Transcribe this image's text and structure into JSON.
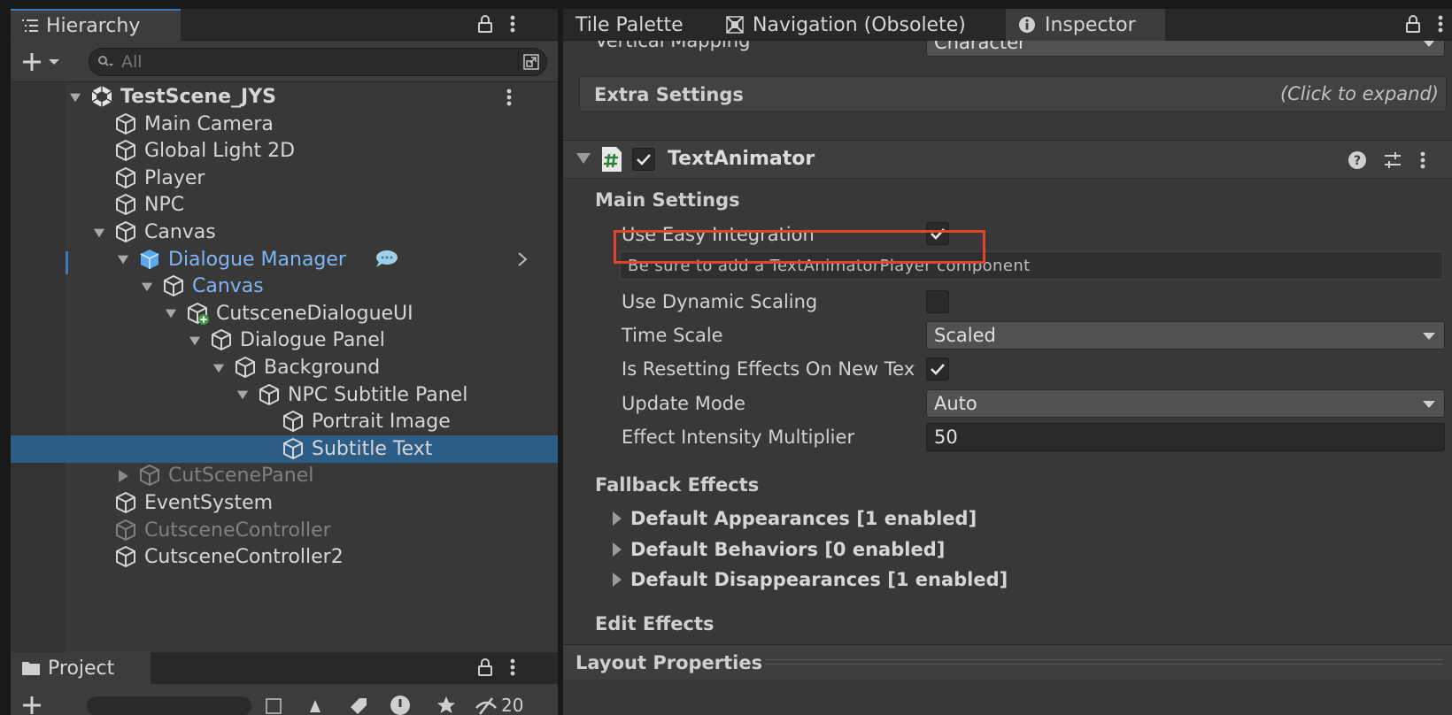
{
  "hierarchy": {
    "tab_label": "Hierarchy",
    "search_placeholder": "All",
    "rows": [
      {
        "label": "TestScene_JYS",
        "depth": 0,
        "arrow": "down",
        "icon": "unity-scene",
        "style": "bold"
      },
      {
        "label": "Main Camera",
        "depth": 1,
        "arrow": "",
        "icon": "cube",
        "style": ""
      },
      {
        "label": "Global Light 2D",
        "depth": 1,
        "arrow": "",
        "icon": "cube",
        "style": ""
      },
      {
        "label": "Player",
        "depth": 1,
        "arrow": "",
        "icon": "cube",
        "style": ""
      },
      {
        "label": "NPC",
        "depth": 1,
        "arrow": "",
        "icon": "cube",
        "style": ""
      },
      {
        "label": "Canvas",
        "depth": 1,
        "arrow": "down",
        "icon": "cube",
        "style": ""
      },
      {
        "label": "Dialogue Manager",
        "depth": 2,
        "arrow": "down",
        "icon": "prefab-cube",
        "style": "blue"
      },
      {
        "label": "Canvas",
        "depth": 3,
        "arrow": "down",
        "icon": "cube",
        "style": "blue"
      },
      {
        "label": "CutsceneDialogueUI",
        "depth": 4,
        "arrow": "down",
        "icon": "cube-added",
        "style": ""
      },
      {
        "label": "Dialogue Panel",
        "depth": 5,
        "arrow": "down",
        "icon": "cube",
        "style": ""
      },
      {
        "label": "Background",
        "depth": 6,
        "arrow": "down",
        "icon": "cube",
        "style": ""
      },
      {
        "label": "NPC Subtitle Panel",
        "depth": 7,
        "arrow": "down",
        "icon": "cube",
        "style": ""
      },
      {
        "label": "Portrait Image",
        "depth": 8,
        "arrow": "",
        "icon": "cube",
        "style": ""
      },
      {
        "label": "Subtitle Text",
        "depth": 8,
        "arrow": "",
        "icon": "cube",
        "style": "selected"
      },
      {
        "label": "CutScenePanel",
        "depth": 2,
        "arrow": "right",
        "icon": "cube",
        "style": "dim"
      },
      {
        "label": "EventSystem",
        "depth": 1,
        "arrow": "",
        "icon": "cube",
        "style": ""
      },
      {
        "label": "CutsceneController",
        "depth": 1,
        "arrow": "",
        "icon": "cube",
        "style": "dim"
      },
      {
        "label": "CutsceneController2",
        "depth": 1,
        "arrow": "",
        "icon": "cube",
        "style": ""
      }
    ]
  },
  "project": {
    "tab_label": "Project",
    "hidden_count": "20"
  },
  "right_tabs": {
    "tile_palette": "Tile Palette",
    "navigation": "Navigation (Obsolete)",
    "inspector": "Inspector"
  },
  "inspector": {
    "vertical_mapping_label": "Vertical Mapping",
    "vertical_mapping_value": "Character",
    "extra_settings_label": "Extra Settings",
    "extra_settings_hint": "(Click to expand)",
    "component_name": "TextAnimator",
    "main_settings_label": "Main Settings",
    "use_easy_integration_label": "Use Easy Integration",
    "use_easy_integration_checked": true,
    "info_message": "Be sure to add a TextAnimatorPlayer component",
    "use_dynamic_scaling_label": "Use Dynamic Scaling",
    "use_dynamic_scaling_checked": false,
    "time_scale_label": "Time Scale",
    "time_scale_value": "Scaled",
    "resetting_effects_label": "Is Resetting Effects On New Text",
    "resetting_effects_checked": true,
    "update_mode_label": "Update Mode",
    "update_mode_value": "Auto",
    "effect_intensity_label": "Effect Intensity Multiplier",
    "effect_intensity_value": "50",
    "fallback_effects_label": "Fallback Effects",
    "default_appearances": "Default Appearances [1 enabled]",
    "default_behaviors": "Default Behaviors [0 enabled]",
    "default_disappearances": "Default Disappearances [1 enabled]",
    "edit_effects_label": "Edit Effects",
    "layout_properties_label": "Layout Properties"
  },
  "colors": {
    "selection": "#2c5d87",
    "prefab_blue": "#7fb5f5",
    "highlight_red": "#e0442a",
    "script_icon_green": "#2e7d32"
  }
}
